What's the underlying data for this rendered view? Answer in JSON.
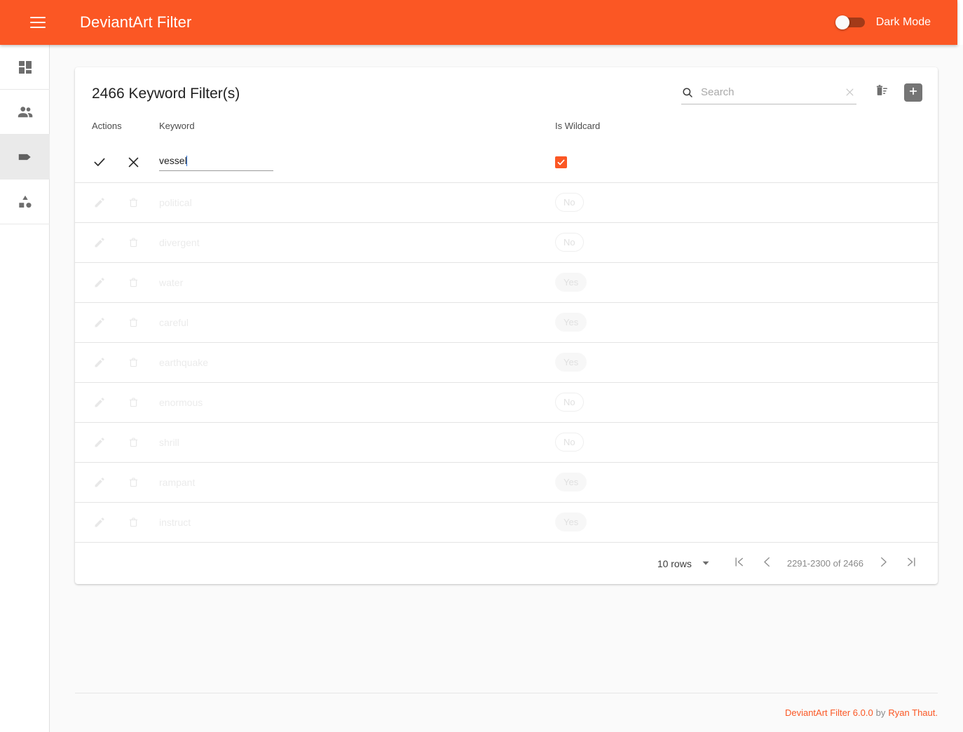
{
  "header": {
    "title": "DeviantArt Filter",
    "menu_icon": "hamburger-icon",
    "dark_mode_label": "Dark Mode",
    "dark_mode_on": false,
    "accent_color": "#FB5724"
  },
  "sidebar": {
    "items": [
      {
        "name": "dashboard",
        "icon": "dashboard-icon",
        "active": false
      },
      {
        "name": "users",
        "icon": "people-icon",
        "active": false
      },
      {
        "name": "keywords",
        "icon": "tag-icon",
        "active": true
      },
      {
        "name": "categories",
        "icon": "category-icon",
        "active": false
      }
    ]
  },
  "card": {
    "title": "2466 Keyword Filter(s)",
    "search": {
      "placeholder": "Search",
      "value": "",
      "search_icon": "search-icon",
      "clear_icon": "close-icon"
    },
    "tools": {
      "delete_sweep_icon": "delete-sweep-icon",
      "add_icon": "add-box-icon"
    },
    "columns": {
      "actions": "Actions",
      "keyword": "Keyword",
      "is_wildcard": "Is Wildcard"
    },
    "edit_row": {
      "confirm_icon": "check-icon",
      "cancel_icon": "close-icon",
      "keyword_value": "vessel",
      "is_wildcard_checked": true,
      "checkbox_color": "#FB5724"
    },
    "rows": [
      {
        "keyword": "political",
        "is_wildcard": "No"
      },
      {
        "keyword": "divergent",
        "is_wildcard": "No"
      },
      {
        "keyword": "water",
        "is_wildcard": "Yes"
      },
      {
        "keyword": "careful",
        "is_wildcard": "Yes"
      },
      {
        "keyword": "earthquake",
        "is_wildcard": "Yes"
      },
      {
        "keyword": "enormous",
        "is_wildcard": "No"
      },
      {
        "keyword": "shrill",
        "is_wildcard": "No"
      },
      {
        "keyword": "rampant",
        "is_wildcard": "Yes"
      },
      {
        "keyword": "instruct",
        "is_wildcard": "Yes"
      }
    ],
    "paginator": {
      "rows_per_page": "10 rows",
      "range_label": "2291-2300 of 2466",
      "first_icon": "first-page-icon",
      "prev_icon": "chevron-left-icon",
      "next_icon": "chevron-right-icon",
      "last_icon": "last-page-icon",
      "dropdown_icon": "chevron-down-icon"
    }
  },
  "footer": {
    "product": "DeviantArt Filter 6.0.0",
    "by": "by",
    "author": "Ryan Thaut."
  }
}
